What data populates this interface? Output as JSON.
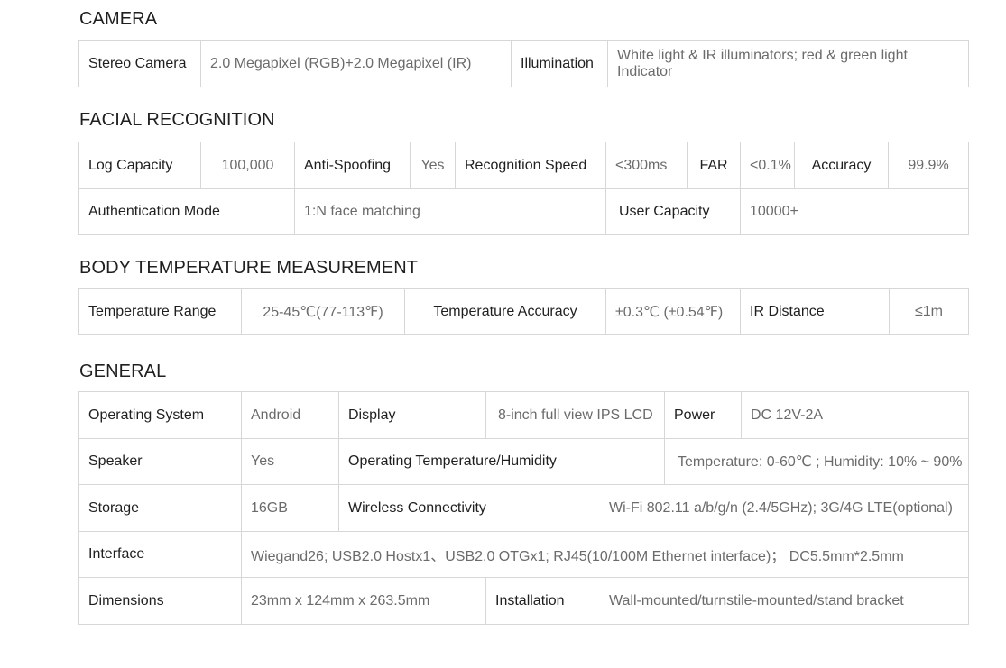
{
  "camera": {
    "title": "CAMERA",
    "stereo_label": "Stereo Camera",
    "stereo_value": "2.0 Megapixel (RGB)+2.0 Megapixel (IR)",
    "illum_label": "Illumination",
    "illum_value": "White light & IR illuminators; red & green light Indicator"
  },
  "facial": {
    "title": "FACIAL RECOGNITION",
    "log_label": "Log Capacity",
    "log_value": "100,000",
    "spoof_label": "Anti-Spoofing",
    "spoof_value": "Yes",
    "speed_label": "Recognition Speed",
    "speed_value": "<300ms",
    "far_label": "FAR",
    "far_value": "<0.1%",
    "acc_label": "Accuracy",
    "acc_value": "99.9%",
    "auth_label": "Authentication Mode",
    "auth_value": "1:N face matching",
    "ucap_label": "User Capacity",
    "ucap_value": "10000+"
  },
  "body_temp": {
    "title": "BODY TEMPERATURE MEASUREMENT",
    "range_label": "Temperature Range",
    "range_value": "25-45℃(77-113℉)",
    "acc_label": "Temperature Accuracy",
    "acc_value": "±0.3℃ (±0.54℉)",
    "ir_label": "IR Distance",
    "ir_value": "≤1m"
  },
  "general": {
    "title": "GENERAL",
    "os_label": "Operating System",
    "os_value": "Android",
    "display_label": "Display",
    "display_value": "8-inch full view IPS LCD",
    "power_label": "Power",
    "power_value": "DC 12V-2A",
    "speaker_label": "Speaker",
    "speaker_value": "Yes",
    "optemp_label": "Operating Temperature/Humidity",
    "optemp_value": "Temperature: 0-60℃ ; Humidity: 10% ~ 90%",
    "storage_label": "Storage",
    "storage_value": "16GB",
    "wireless_label": "Wireless Connectivity",
    "wireless_value": "Wi-Fi 802.11 a/b/g/n (2.4/5GHz); 3G/4G LTE(optional)",
    "interface_label": "Interface",
    "interface_value": "Wiegand26; USB2.0 Hostx1、USB2.0 OTGx1; RJ45(10/100M Ethernet interface)； DC5.5mm*2.5mm",
    "dim_label": "Dimensions",
    "dim_value": "23mm x 124mm x 263.5mm",
    "install_label": "Installation",
    "install_value": "Wall-mounted/turnstile-mounted/stand bracket"
  }
}
